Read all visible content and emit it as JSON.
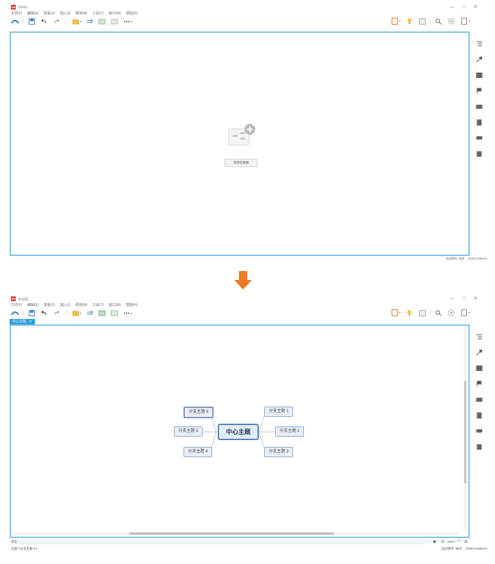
{
  "app": {
    "logo_text": "XM",
    "title": "XMind",
    "title_after": "无标题"
  },
  "window_controls": [
    "—",
    "□",
    "✕"
  ],
  "menu": [
    "文件(F)",
    "编辑(E)",
    "查看(V)",
    "插入(I)",
    "修改(M)",
    "工具(T)",
    "窗口(W)",
    "帮助(H)"
  ],
  "toolbar_icons": [
    "home-icon",
    "save-icon",
    "undo-icon",
    "redo-icon",
    "topic-icon",
    "relationship-icon",
    "boundary-icon",
    "summary-icon",
    "more-icon",
    "marker-icon",
    "idea-icon",
    "image-icon",
    "search-icon",
    "zoom-icon",
    "export-icon"
  ],
  "sidebar_icons": [
    "outline-icon",
    "format-icon",
    "image-icon",
    "marker-icon",
    "notes-icon",
    "document-icon",
    "comment-icon",
    "task-icon"
  ],
  "empty_state": {
    "new_map_button": "新建思维图"
  },
  "doc_tab": {
    "label": "中心主题",
    "close": "✕"
  },
  "mindmap": {
    "center": "中心主题",
    "topics": [
      "分支主题 1",
      "分支主题 2",
      "分支主题 3",
      "分支主题 4",
      "分支主题 5",
      "分支主题 6"
    ]
  },
  "status_bar": {
    "top": "自动保存: 关闭",
    "account": "1026071665131",
    "bottom": "自动保存: 关闭",
    "selection": "主题 (\"分支主题 6\")"
  },
  "filter": {
    "label": "筛选"
  },
  "zoom": {
    "value": "100%"
  },
  "colors": {
    "accent": "#2f9fd8",
    "canvas_border": "#7fc3e8",
    "arrow": "#f07a23",
    "topic_border": "#8aa9cd"
  }
}
